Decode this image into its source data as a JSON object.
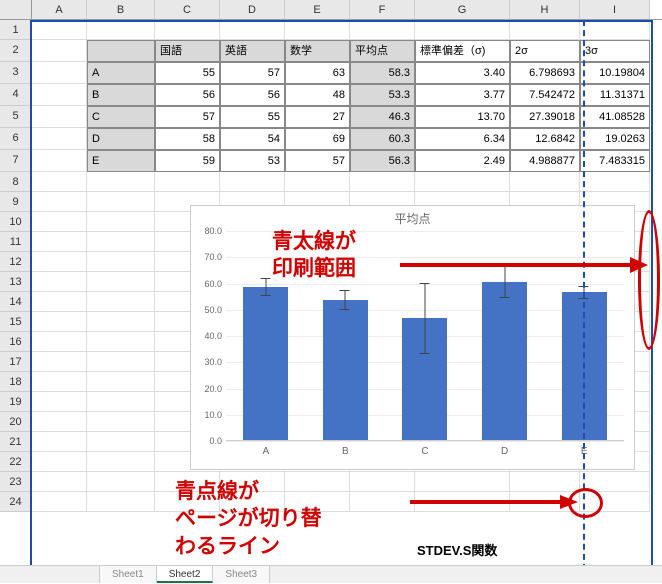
{
  "columns": [
    "A",
    "B",
    "C",
    "D",
    "E",
    "F",
    "G",
    "H",
    "I"
  ],
  "row_numbers": [
    1,
    2,
    3,
    4,
    5,
    6,
    7,
    8,
    9,
    10,
    11,
    12,
    13,
    14,
    15,
    16,
    17,
    18,
    19,
    20,
    21,
    22,
    23,
    24
  ],
  "headers": {
    "B": "",
    "C": "国語",
    "D": "英語",
    "E": "数学",
    "F": "平均点",
    "G": "標準偏差（σ)",
    "H": "2σ",
    "I": "3σ"
  },
  "rows": [
    {
      "label": "A",
      "kokugo": 55,
      "eigo": 57,
      "sugaku": 63,
      "avg": "58.3",
      "sd": "3.40",
      "sd2": "6.798693",
      "sd3": "10.19804"
    },
    {
      "label": "B",
      "kokugo": 56,
      "eigo": 56,
      "sugaku": 48,
      "avg": "53.3",
      "sd": "3.77",
      "sd2": "7.542472",
      "sd3": "11.31371"
    },
    {
      "label": "C",
      "kokugo": 57,
      "eigo": 55,
      "sugaku": 27,
      "avg": "46.3",
      "sd": "13.70",
      "sd2": "27.39018",
      "sd3": "41.08528"
    },
    {
      "label": "D",
      "kokugo": 58,
      "eigo": 54,
      "sugaku": 69,
      "avg": "60.3",
      "sd": "6.34",
      "sd2": "12.6842",
      "sd3": "19.0263"
    },
    {
      "label": "E",
      "kokugo": 59,
      "eigo": 53,
      "sugaku": 57,
      "avg": "56.3",
      "sd": "2.49",
      "sd2": "4.988877",
      "sd3": "7.483315"
    }
  ],
  "annotation1_line1": "青太線が",
  "annotation1_line2": "印刷範囲",
  "annotation2_line1": "青点線が",
  "annotation2_line2": "ページが切り替",
  "annotation2_line3": "わるライン",
  "stdev_text": "STDEV.S関数",
  "chart_data": {
    "type": "bar",
    "title": "平均点",
    "categories": [
      "A",
      "B",
      "C",
      "D",
      "E"
    ],
    "values": [
      58.3,
      53.3,
      46.3,
      60.3,
      56.3
    ],
    "errors": [
      3.4,
      3.77,
      13.7,
      6.34,
      2.49
    ],
    "y_ticks": [
      0,
      10,
      20,
      30,
      40,
      50,
      60,
      70,
      80
    ],
    "ylim": [
      0,
      80
    ],
    "xlabel": "",
    "ylabel": ""
  },
  "sheet_tabs": [
    "Sheet1",
    "Sheet2",
    "Sheet3"
  ]
}
